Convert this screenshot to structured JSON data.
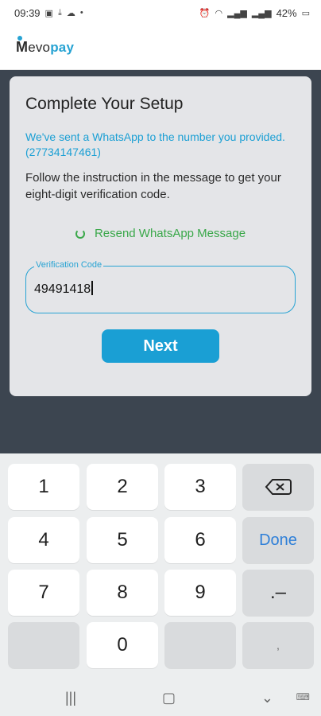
{
  "status_bar": {
    "time": "09:39",
    "battery": "42%"
  },
  "app": {
    "logo_m": "M",
    "logo_evo": "evo",
    "logo_pay": "pay"
  },
  "card": {
    "title": "Complete Your Setup",
    "info_blue": "We've sent a WhatsApp to the number you provided. (27734147461)",
    "info_dark": "Follow the instruction in the message to get your eight-digit verification code.",
    "resend": "Resend WhatsApp Message",
    "field_label": "Verification Code",
    "field_value": "49491418",
    "next": "Next"
  },
  "keyboard": {
    "keys": [
      "1",
      "2",
      "3",
      "4",
      "5",
      "6",
      "7",
      "8",
      "9",
      "0"
    ],
    "done": "Done",
    "dot_dash": ".–",
    "comma": ","
  },
  "colors": {
    "accent": "#1a9fd4",
    "green": "#3aa84a",
    "dark": "#3c4550",
    "card": "#e4e5e8"
  }
}
